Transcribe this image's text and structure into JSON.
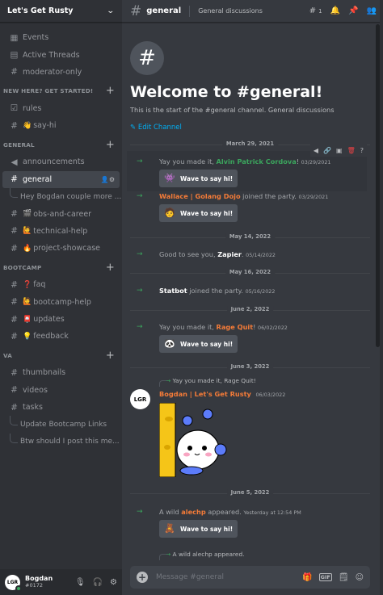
{
  "server": {
    "name": "Let's Get Rusty"
  },
  "sidebar": {
    "top_items": [
      {
        "label": "Events",
        "icon": "calendar-icon"
      },
      {
        "label": "Active Threads",
        "icon": "threads-icon"
      },
      {
        "label": "moderator-only",
        "icon": "hash-icon"
      }
    ],
    "categories": [
      {
        "label": "NEW HERE? GET STARTED!",
        "channels": [
          "rules",
          "say-hi"
        ]
      },
      {
        "label": "GENERAL",
        "channels": [
          "announcements",
          "general",
          "obs-and-career",
          "technical-help",
          "project-showcase"
        ]
      },
      {
        "label": "BOOTCAMP",
        "channels": [
          "faq",
          "bootcamp-help",
          "updates",
          "feedback"
        ]
      },
      {
        "label": "VA",
        "channels": [
          "thumbnails",
          "videos",
          "tasks"
        ]
      }
    ],
    "threads_general": [
      "Hey Bogdan couple more ..."
    ],
    "threads_va": [
      "Update Bootcamp Links",
      "Btw should I post this me..."
    ],
    "emoji": {
      "say-hi": "👋",
      "obs-and-career": "🎬",
      "technical-help": "🙋",
      "project-showcase": "🔥",
      "faq": "❓",
      "bootcamp-help": "🙋",
      "updates": "📮",
      "feedback": "💡"
    }
  },
  "user": {
    "name": "Bogdan",
    "discriminator": "#0172",
    "avatar_text": "LGR"
  },
  "channel": {
    "name": "general",
    "topic": "General discussions",
    "threads_count": "1"
  },
  "welcome": {
    "title": "Welcome to #general!",
    "subtitle": "This is the start of the #general channel. General discussions",
    "edit": "Edit Channel"
  },
  "messages": {
    "d1": "March 29, 2021",
    "m1": {
      "pre": "Yay you made it, ",
      "name": "Alvin Patrick Cordova",
      "post": "!",
      "time": "03/29/2021",
      "wave": "Wave to say hi!"
    },
    "m2": {
      "name": "Wallace | Golang Dojo",
      "post": " joined the party.",
      "time": "03/29/2021",
      "wave": "Wave to say hi!"
    },
    "d2": "May 14, 2022",
    "m3": {
      "pre": "Good to see you, ",
      "name": "Zapier",
      "post": ".",
      "time": "05/14/2022"
    },
    "d3": "May 16, 2022",
    "m4": {
      "name": "Statbot",
      "post": " joined the party.",
      "time": "05/16/2022"
    },
    "d4": "June 2, 2022",
    "m5": {
      "pre": "Yay you made it, ",
      "name": "Rage Quit",
      "post": "!",
      "time": "06/02/2022",
      "wave": "Wave to say hi!"
    },
    "d5": "June 3, 2022",
    "m6": {
      "reply": "Yay you made it, Rage Quit!",
      "name": "Bogdan | Let's Get Rusty",
      "time": "06/03/2022",
      "avatar_text": "LGR"
    },
    "d6": "June 5, 2022",
    "m7": {
      "pre": "A wild ",
      "name": "alechp",
      "post": " appeared.",
      "time": "Yesterday at 12:54 PM",
      "wave": "Wave to say hi!"
    },
    "m8": {
      "reply": "A wild alechp appeared."
    }
  },
  "composer": {
    "placeholder": "Message #general"
  },
  "colors": {
    "accent": "#00aff4",
    "green": "#3ba55d",
    "orange": "#f47b38",
    "danger": "#ed4245"
  }
}
